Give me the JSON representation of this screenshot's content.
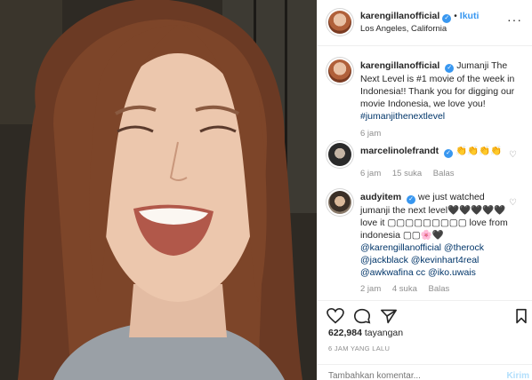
{
  "header": {
    "username": "karengillanofficial",
    "follow_label": "Ikuti",
    "location": "Los Angeles, California",
    "dot": "•",
    "more": "···"
  },
  "caption": {
    "username": "karengillanofficial",
    "text": "Jumanji The Next Level is #1 movie of the week in Indonesia!! Thank you for digging our movie Indonesia, we love you!",
    "hashtag": "#jumanjithenextlevel",
    "age": "6 jam"
  },
  "comments": [
    {
      "username": "marcelinolefrandt",
      "text": "👏👏👏👏",
      "age": "6 jam",
      "likes": "15 suka",
      "reply": "Balas"
    },
    {
      "username": "audyitem",
      "text": "we just watched jumanji the next level🖤🖤🖤🖤🖤 love it ▢▢▢▢▢▢▢▢▢ love from indonesia ▢▢🌸🖤",
      "mentions_1": "@karengillanofficial @therock",
      "mentions_2": "@jackblack @kevinhart4real",
      "mentions_3": "@awkwafina cc @iko.uwais",
      "age": "2 jam",
      "likes": "4 suka",
      "reply": "Balas"
    }
  ],
  "stats": {
    "views": "622,984",
    "views_label": "tayangan",
    "posted": "6 JAM YANG LALU"
  },
  "composer": {
    "placeholder": "Tambahkan komentar...",
    "post_label": "Kirim"
  },
  "colors": {
    "link": "#003569",
    "accent": "#3897f0",
    "meta": "#8e8e8e"
  }
}
